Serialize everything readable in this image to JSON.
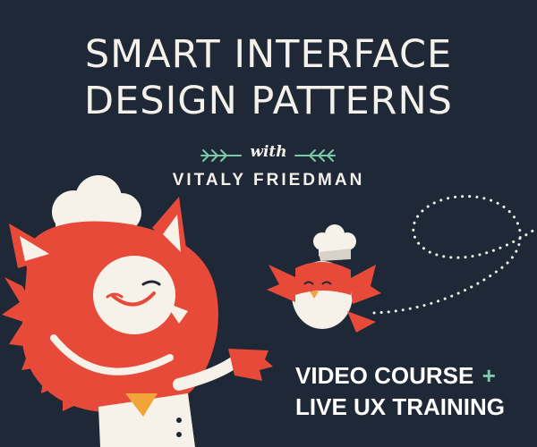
{
  "banner": {
    "title_line1": "SMART INTERFACE",
    "title_line2": "DESIGN PATTERNS",
    "with": "with",
    "author": "VITALY FRIEDMAN",
    "course_line1": "VIDEO COURSE",
    "course_plus": "+",
    "course_line2": "LIVE UX TRAINING"
  },
  "colors": {
    "background": "#1e2836",
    "title": "#f4f1ea",
    "mascot_red": "#e84a3a",
    "accent_teal": "#7cc9a7",
    "cream": "#f6f2ea"
  },
  "icons": [
    "leaf-left-icon",
    "leaf-right-icon",
    "cat-chef-mascot",
    "bird-chef-mascot",
    "dotted-flight-path"
  ]
}
